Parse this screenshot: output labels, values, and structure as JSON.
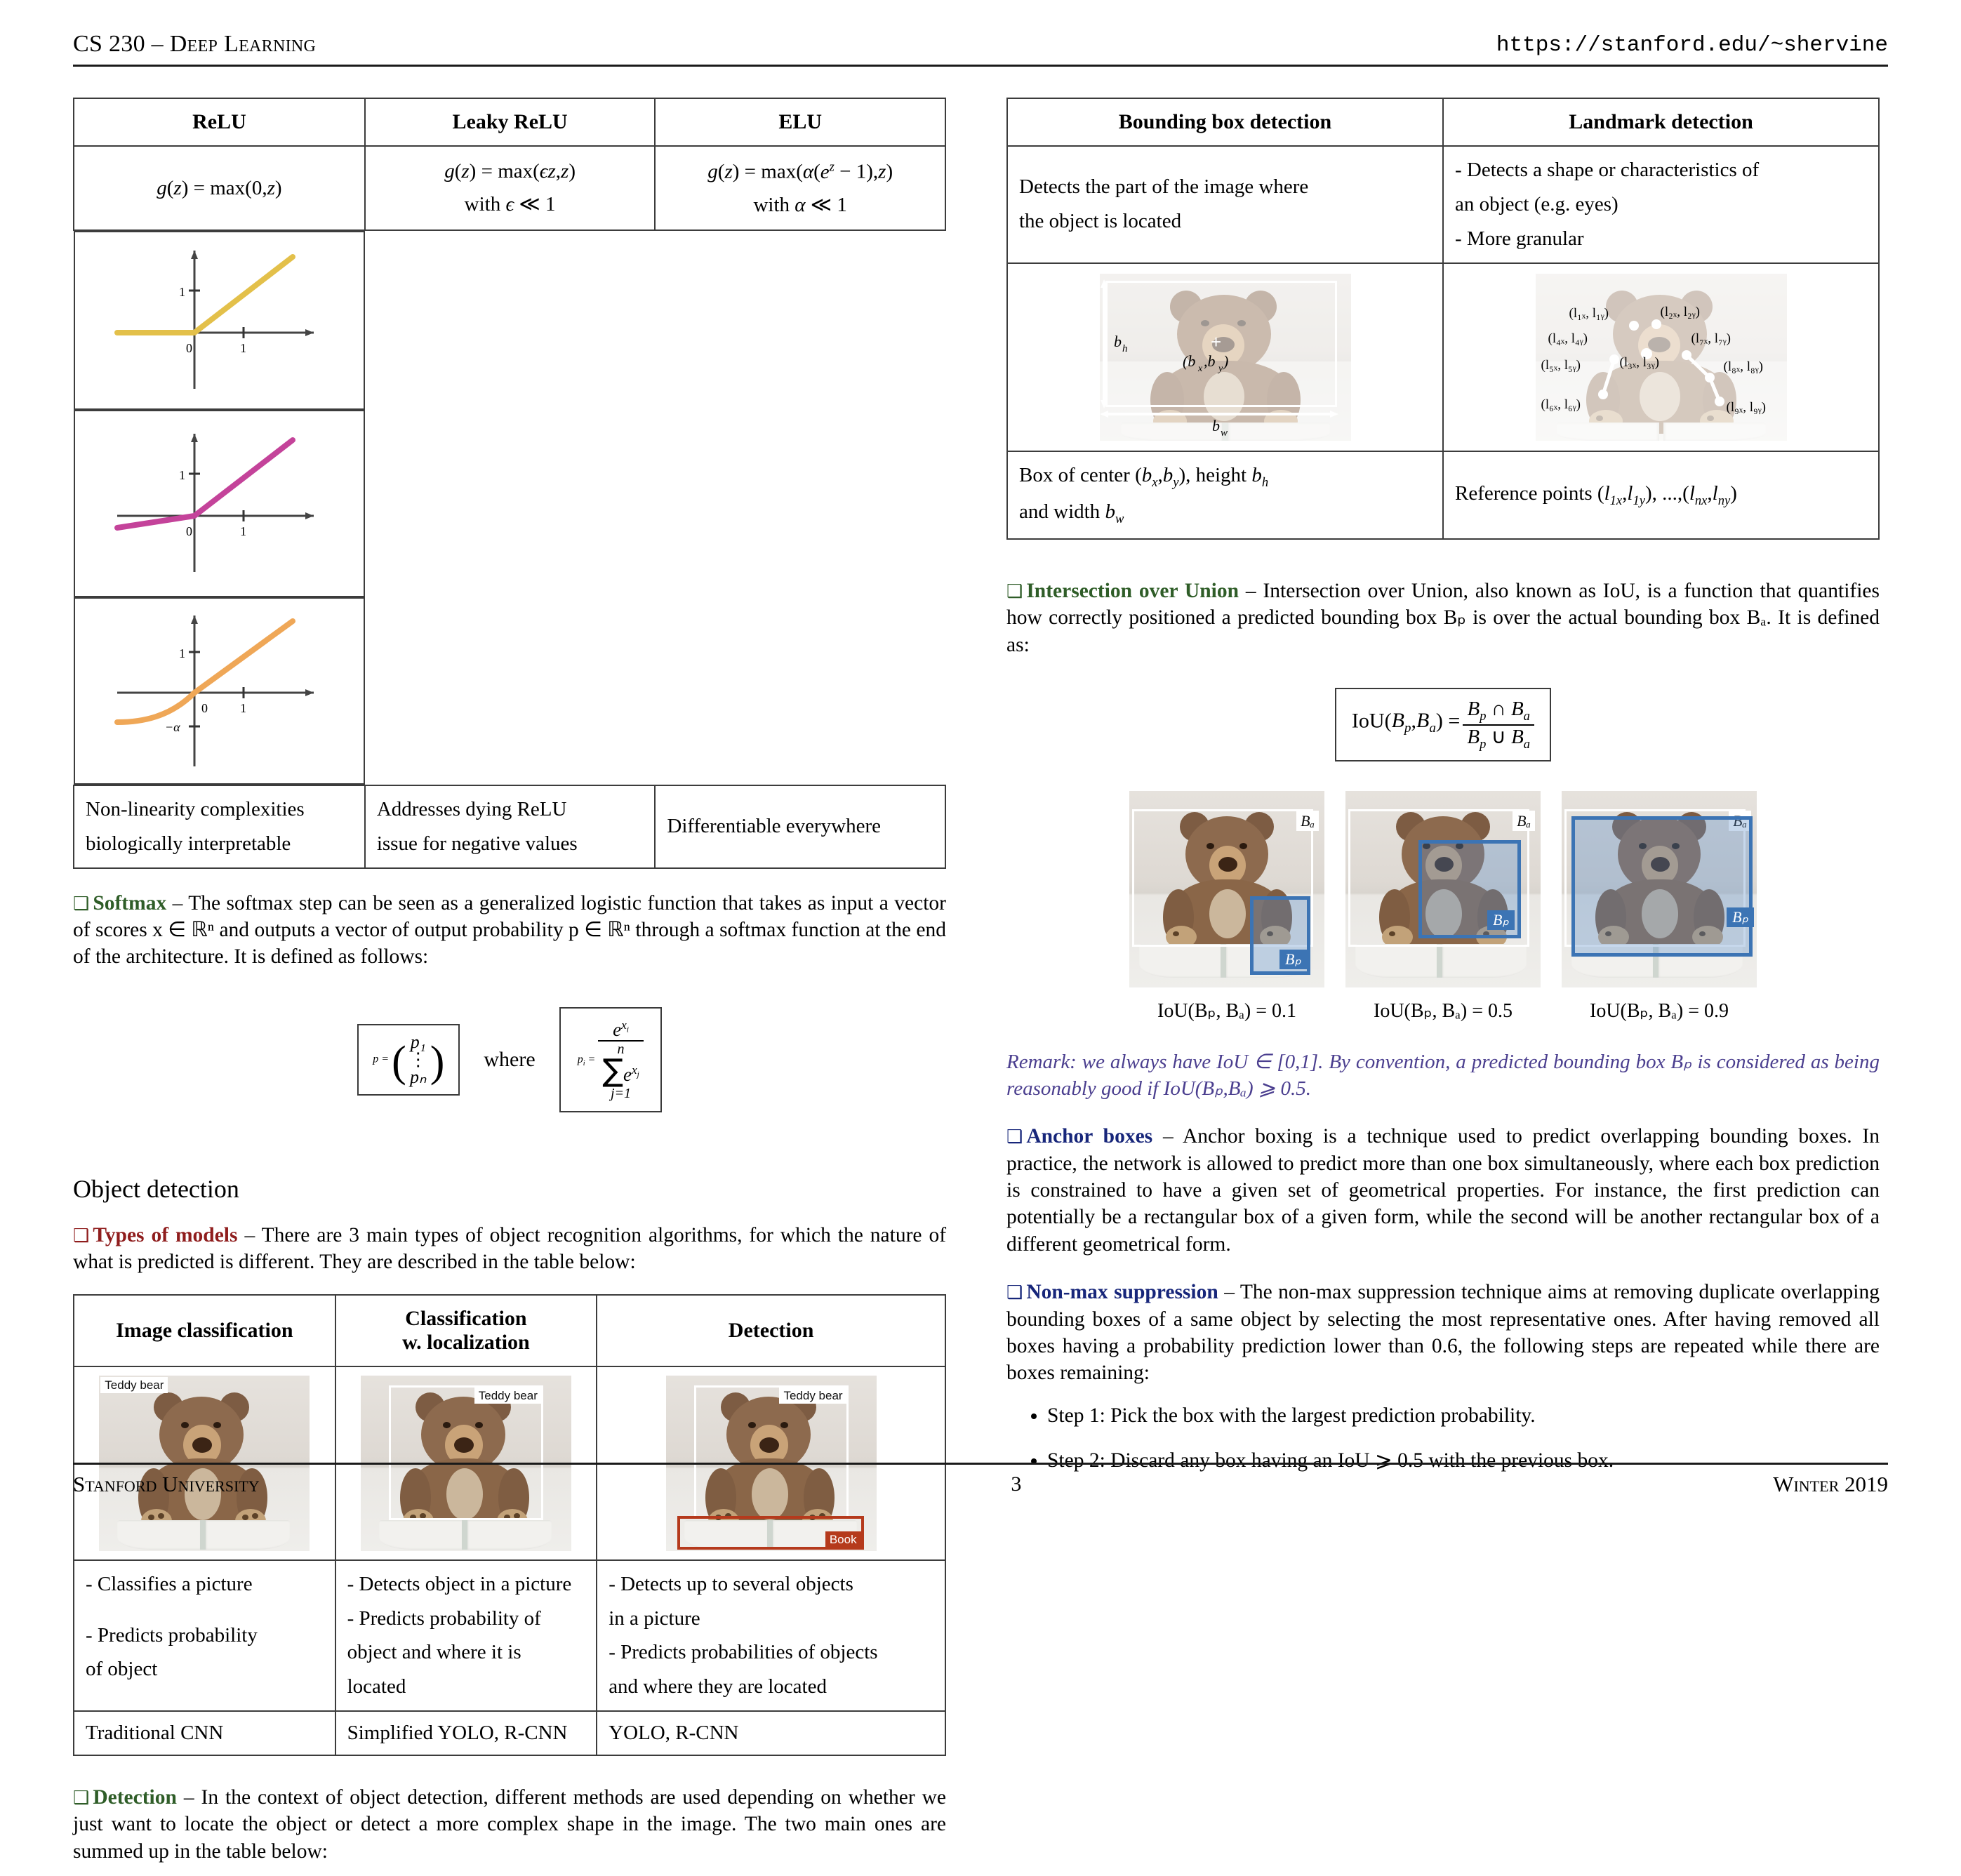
{
  "header": {
    "course": "CS 230 – Deep Learning",
    "url": "https://stanford.edu/~shervine"
  },
  "footer": {
    "institution": "Stanford University",
    "page": "3",
    "term": "Winter 2019"
  },
  "colors": {
    "green": "#2f5d28",
    "red": "#8f1d1d",
    "blue": "#17267a",
    "purple": "#4b3f8f",
    "relu_curve": "#e3c04a",
    "leaky_relu_curve": "#c4439a",
    "elu_curve": "#eda košt"
  },
  "activation_table": {
    "headers": [
      "ReLU",
      "Leaky ReLU",
      "ELU"
    ],
    "formulas": [
      {
        "main": "g(z) = max(0,z)",
        "cond": ""
      },
      {
        "main": "g(z) = max(ϵz,z)",
        "cond": "with ϵ ≪ 1"
      },
      {
        "main": "g(z) = max(α(e^z − 1),z)",
        "cond": "with α ≪ 1"
      }
    ],
    "plots": [
      {
        "name": "relu-plot",
        "color": "#e3c04a",
        "xticks": [
          "0",
          "1"
        ],
        "yticks": [
          "1"
        ],
        "negtick": ""
      },
      {
        "name": "leaky-relu-plot",
        "color": "#c4439a",
        "xticks": [
          "0",
          "1"
        ],
        "yticks": [
          "1"
        ],
        "negtick": ""
      },
      {
        "name": "elu-plot",
        "color": "#efa757",
        "xticks": [
          "0",
          "1"
        ],
        "yticks": [
          "1"
        ],
        "negtick": "−α"
      }
    ],
    "notes": [
      [
        "Non-linearity complexities",
        "biologically interpretable"
      ],
      [
        "Addresses dying ReLU",
        "issue for negative values"
      ],
      [
        "Differentiable everywhere"
      ]
    ]
  },
  "softmax": {
    "title": "Softmax",
    "body": "– The softmax step can be seen as a generalized logistic function that takes as input a vector of scores x ∈ ℝⁿ and outputs a vector of output probability p ∈ ℝⁿ through a softmax function at the end of the architecture. It is defined as follows:",
    "where": "where",
    "vector_top": "p₁",
    "vector_bottom": "pₙ",
    "lhs": "p =",
    "rhs_lhs": "pᵢ =",
    "rhs_num": "e^{xᵢ}",
    "rhs_den_sum": "∑",
    "rhs_den_top": "n",
    "rhs_den_bottom": "j=1",
    "rhs_den_term": "e^{xⱼ}"
  },
  "object_detection": {
    "section_title": "Object detection",
    "types_of_models": {
      "title": "Types of models",
      "body": "– There are 3 main types of object recognition algorithms, for which the nature of what is predicted is different. They are described in the table below:"
    },
    "table": {
      "headers": [
        "Image classification",
        "Classification\nw. localization",
        "Detection"
      ],
      "header_lines": [
        [
          "Image classification"
        ],
        [
          "Classification",
          "w. localization"
        ],
        [
          "Detection"
        ]
      ],
      "image_labels": [
        [
          "Teddy bear"
        ],
        [
          "Teddy bear"
        ],
        [
          "Teddy bear",
          "Book"
        ]
      ],
      "descriptions": [
        [
          "- Classifies a picture",
          "- Predicts probability",
          "of object"
        ],
        [
          "- Detects object in a picture",
          "- Predicts probability of",
          "object and where it is",
          "located"
        ],
        [
          "- Detects up to several objects",
          "in a picture",
          "- Predicts probabilities of objects",
          "and where they are located"
        ]
      ],
      "models": [
        "Traditional CNN",
        "Simplified YOLO, R-CNN",
        "YOLO, R-CNN"
      ]
    },
    "detection": {
      "title": "Detection",
      "body": "– In the context of object detection, different methods are used depending on whether we just want to locate the object or detect a more complex shape in the image. The two main ones are summed up in the table below:"
    }
  },
  "detection_table": {
    "headers": [
      "Bounding box detection",
      "Landmark detection"
    ],
    "descriptions": [
      [
        "Detects the part of the image where",
        "the object is located"
      ],
      [
        "- Detects a shape or characteristics of",
        "an object (e.g. eyes)",
        "- More granular"
      ]
    ],
    "bbox_labels": {
      "height": "b_h",
      "width": "b_w",
      "center": "(b_x, b_y)"
    },
    "landmark_labels": [
      "(l₁ₓ, l₁ᵧ)",
      "(l₂ₓ, l₂ᵧ)",
      "(l₃ₓ, l₃ᵧ)",
      "(l₄ₓ, l₄ᵧ)",
      "(l₅ₓ, l₅ᵧ)",
      "(l₆ₓ, l₆ᵧ)",
      "(l₇ₓ, l₇ᵧ)",
      "(l₈ₓ, l₈ᵧ)",
      "(l₉ₓ, l₉ᵧ)"
    ],
    "summaries": [
      "Box of center (b_x,b_y), height b_h and width b_w",
      "Reference points (l_1x,l_1y), ...,(l_nx,l_ny)"
    ]
  },
  "iou": {
    "title": "Intersection over Union",
    "body": "– Intersection over Union, also known as IoU, is a function that quantifies how correctly positioned a predicted bounding box Bₚ is over the actual bounding box Bₐ. It is defined as:",
    "formula": {
      "lhs": "IoU(Bₚ,Bₐ) =",
      "num": "Bₚ ∩ Bₐ",
      "den": "Bₚ ∪ Bₐ"
    },
    "examples": [
      {
        "name": "iou-01",
        "caption": "IoU(Bₚ, Bₐ) = 0.1",
        "value": 0.1,
        "actual_label": "Bₐ",
        "pred_label": "Bₚ"
      },
      {
        "name": "iou-05",
        "caption": "IoU(Bₚ, Bₐ) = 0.5",
        "value": 0.5,
        "actual_label": "Bₐ",
        "pred_label": "Bₚ"
      },
      {
        "name": "iou-09",
        "caption": "IoU(Bₚ, Bₐ) = 0.9",
        "value": 0.9,
        "actual_label": "Bₐ",
        "pred_label": "Bₚ"
      }
    ],
    "remark": "Remark: we always have IoU ∈ [0,1]. By convention, a predicted bounding box Bₚ is considered as being reasonably good if IoU(Bₚ,Bₐ) ⩾ 0.5."
  },
  "anchor_boxes": {
    "title": "Anchor boxes",
    "body": "– Anchor boxing is a technique used to predict overlapping bounding boxes. In practice, the network is allowed to predict more than one box simultaneously, where each box prediction is constrained to have a given set of geometrical properties. For instance, the first prediction can potentially be a rectangular box of a given form, while the second will be another rectangular box of a different geometrical form."
  },
  "non_max_suppression": {
    "title": "Non-max suppression",
    "body": "– The non-max suppression technique aims at removing duplicate overlapping bounding boxes of a same object by selecting the most representative ones. After having removed all boxes having a probability prediction lower than 0.6, the following steps are repeated while there are boxes remaining:",
    "steps": [
      "Step 1: Pick the box with the largest prediction probability.",
      "Step 2: Discard any box having an IoU ⩾ 0.5 with the previous box."
    ]
  }
}
